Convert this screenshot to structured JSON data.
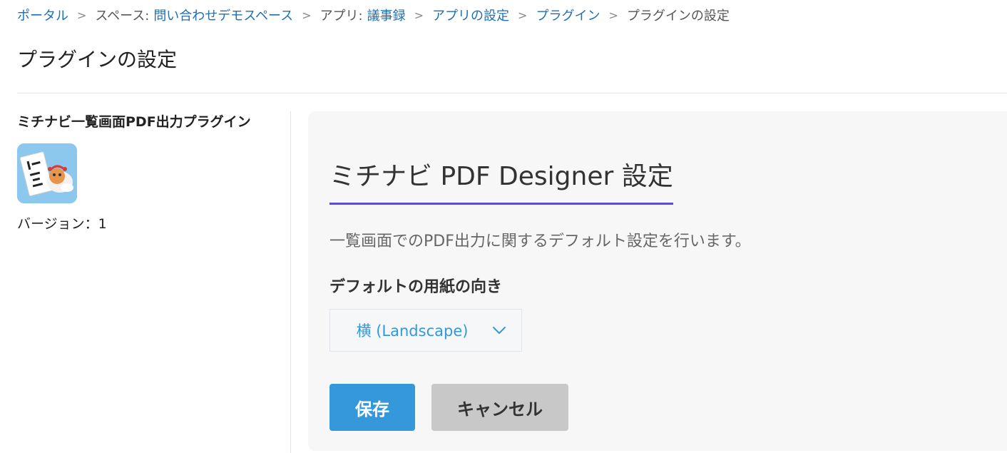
{
  "breadcrumb": {
    "portal": "ポータル",
    "space_prefix": "スペース:",
    "space_name": "問い合わせデモスペース",
    "app_prefix": "アプリ:",
    "app_name": "議事録",
    "app_settings": "アプリの設定",
    "plugins": "プラグイン",
    "current": "プラグインの設定",
    "separator": ">"
  },
  "page": {
    "title": "プラグインの設定"
  },
  "sidebar": {
    "plugin_name": "ミチナビ一覧画面PDF出力プラグイン",
    "version_label": "バージョン：1",
    "icon": "plugin-logo-icon"
  },
  "settings": {
    "title": "ミチナビ PDF Designer 設定",
    "description": "一覧画面でのPDF出力に関するデフォルト設定を行います。",
    "orientation_label": "デフォルトの用紙の向き",
    "orientation_value": "横 (Landscape)",
    "save_label": "保存",
    "cancel_label": "キャンセル"
  },
  "colors": {
    "link": "#1f6fb2",
    "accent_underline": "#5a4fcf",
    "primary_button": "#3498db",
    "secondary_button": "#c8c8c8"
  }
}
